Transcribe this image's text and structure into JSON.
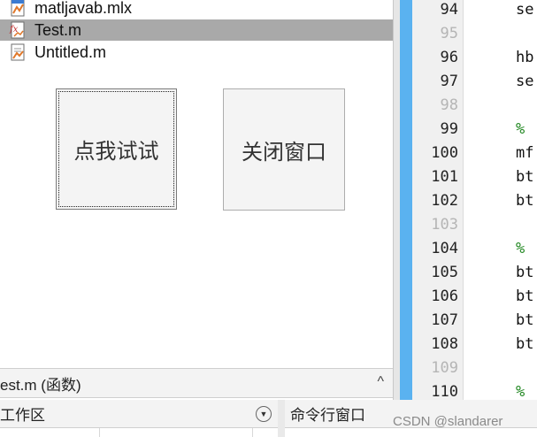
{
  "file_browser": {
    "files": [
      {
        "name": "matljavab.mlx",
        "icon": "live-script-icon",
        "selected": false
      },
      {
        "name": "Test.m",
        "icon": "function-file-icon",
        "selected": true
      },
      {
        "name": "Untitled.m",
        "icon": "script-file-icon",
        "selected": false
      }
    ]
  },
  "buttons": {
    "try_label": "点我试试",
    "close_label": "关闭窗口"
  },
  "details_bar": {
    "text": "est.m  (函数)",
    "caret": "^"
  },
  "workspace": {
    "title": "工作区"
  },
  "command_window": {
    "title": "命令行窗口"
  },
  "watermark": "CSDN @slandarer",
  "editor": {
    "lines": [
      {
        "num": "94",
        "code": "se",
        "kind": "code"
      },
      {
        "num": "95",
        "code": "",
        "kind": "blank"
      },
      {
        "num": "96",
        "code": "hb",
        "kind": "code"
      },
      {
        "num": "97",
        "code": "se",
        "kind": "code"
      },
      {
        "num": "98",
        "code": "",
        "kind": "blank"
      },
      {
        "num": "99",
        "code": "%",
        "kind": "comment"
      },
      {
        "num": "100",
        "code": "mf",
        "kind": "code"
      },
      {
        "num": "101",
        "code": "bt",
        "kind": "code"
      },
      {
        "num": "102",
        "code": "bt",
        "kind": "code"
      },
      {
        "num": "103",
        "code": "",
        "kind": "blank"
      },
      {
        "num": "104",
        "code": "%",
        "kind": "comment"
      },
      {
        "num": "105",
        "code": "bt",
        "kind": "code"
      },
      {
        "num": "106",
        "code": "bt",
        "kind": "code"
      },
      {
        "num": "107",
        "code": "bt",
        "kind": "code"
      },
      {
        "num": "108",
        "code": "bt",
        "kind": "code"
      },
      {
        "num": "109",
        "code": "",
        "kind": "blank"
      },
      {
        "num": "110",
        "code": "%",
        "kind": "comment"
      }
    ]
  },
  "colors": {
    "selection": "#a9a9a9",
    "breakpoint_bar": "#5ab2f0",
    "comment": "#228822"
  }
}
